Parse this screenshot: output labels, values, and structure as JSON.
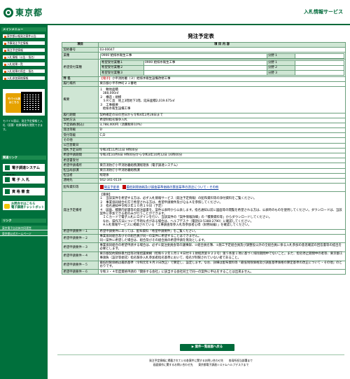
{
  "header": {
    "logo_text": "東京都",
    "site_title": "入札情報サービス"
  },
  "sidebar": {
    "menu_heading": "メインメニュー",
    "menu_items": [
      "東京都公報発注案件公告",
      "予算発注予定情報",
      "発注予定情報",
      "入札情報（公告・指名）",
      "入札結果一覧",
      "入札結果の照会・指名",
      "入札参加資格情報"
    ],
    "mobile_label": "モバイル版\nはこちら",
    "mobile_note": "モバイル版は、発注予定情報と入札（見積）結果情報を閲覧できます。",
    "link_heading": "関連リンク",
    "big_links": [
      "電子調達システム(TOP)",
      "電 子 入 札",
      "資 格 審 査"
    ],
    "chat_label": "お問合せはこちら\n電子調達チャットボット",
    "bottom_heading": "リンク",
    "bottom_links": [
      "東京電子自治体共同運営",
      "東京都公式ホームページ"
    ]
  },
  "main": {
    "page_title": "発注予定表",
    "col_item": "項目",
    "col_content": "項 目 内 容",
    "contract_no_label": "契約番号",
    "contract_no": "03-00047",
    "business_label": "業種",
    "business": "0900 給排水衛生工事",
    "bunya_label": "分野 1",
    "desired_label": "希望受付業種",
    "desired": [
      {
        "label": "希望受付業種１",
        "value": "0900 給排水衛生工事",
        "bunya": "分野 1"
      },
      {
        "label": "希望受付業種２",
        "value": "",
        "bunya": "分野 2"
      },
      {
        "label": "希望受付業種３",
        "value": "",
        "bunya": "分野 3"
      }
    ],
    "title_label": "件 名",
    "title_tag": "【電子】",
    "title": "小平消防署（３）給排水衛生設備改修工事",
    "place_label": "履行場所",
    "place": "東京都小平市仲町２１番地",
    "summary_label": "概要",
    "summary_lines": [
      "１　敷地面積",
      "　388,000㎡",
      "２　構造・規模",
      "　ＳＲＣ造　地上3階地下1階、延床面積2,019.675㎡",
      "３　工事概要",
      "　給排水衛生設備工事"
    ],
    "period_label": "履行期間",
    "period": "契約確定の日の翌日から令和4年2月28日まで",
    "method_label": "契約方法",
    "method": "希望制指名競争入札",
    "price_label": "予定価格(税込)",
    "price": "3,788,400円（消費税率10%）",
    "grade_label": "発注等級",
    "grade": "D",
    "grade2_label": "受付等級",
    "grade2": "C,D",
    "other_label": "その他",
    "other": "",
    "bid_label": "公告登載日",
    "bid": "",
    "open_label": "開札予定日時",
    "open": "令和3年11月11日 9時00分",
    "apply_label": "希望申請期間",
    "apply": "令和3年10月6日 9時00分から令和3年10月12日 16時00分",
    "receipt_label": "希望書受付",
    "receipt": "",
    "dept_label": "希望申請場所",
    "dept": "東京消防庁小平消防署総務課経理係（電子調達システム）",
    "dept2_label": "担当局部課",
    "dept2": "東京消防庁小平消防署総務課",
    "person_label": "担当者",
    "person": "経理係",
    "tel_label": "連絡先",
    "tel": "042-341-0119",
    "docs_label": "配布資料等",
    "doc1": "発注予定表",
    "doc2": "最低制限価格及び調査基準価格の算定基準の改正について・その他",
    "remarks_label": "発注予定備考",
    "remarks_lines": [
      "【重要】",
      "１　当該案件を希望する方は、必ず入札情報サービス（発注予定情報）の配布資料等の添付資料をご覧ください。",
      "２　事業協同組合の方で希望される方は、希望申請要件及びＱ＆Ａを参照してください。",
      "３　指名通知中令和３年１０月１９日（予定）",
      "４　図面、積算内訳書等の発注図書を、案件公表時から公表します。指名通知以前に図面等の閲覧を希望される方は、公表時のものを使用してください。ダウンロードは、当該案件に参加できる者のみが行うことができます。",
      "　ＩＣカードで電子入札にログインを行い、当該案件の「案件情報詳細」の「積算資料等」からダウンロードしてください。",
      "　なお、操作方法について不明な点がある場合は、ヘルプデスク（電話03-5388-2790）に確認してください。",
      "　※入札情報サービスに掲載されている「工事調査等参入札等参加者心得（財務局編）」を確認してください。"
    ],
    "req1_label": "希望申請要件－１",
    "req1": "希望申請要件にあっては、配布資料「希望申請要件」をご覧ください。",
    "req2_label": "希望申請要件－２",
    "req2": "事業協同組合及びその組合員が同一の案件に希望することはできません。\n同一案件に希望した場合は、組合及びその組合員の希望申請を無効とします。",
    "req3_label": "希望申請要件－３",
    "req3": "事業協同組合の希望申請する場合は、必ず①発注委員会等の議事録、②組合員名簿、③施工予定組合員及び調整役以外の全組合員に係る入札参加の意思確認の回答書等の提出を必要とします。",
    "req4_label": "希望申請要件－４",
    "req4": "東京都契約関係暴力団等対策措置要綱（昭和６２年１月１４日付６１財経庶第９２２号）第５条第１項に基づく排除期間中でないこと。また、指名停止期間中の者等、東京都工事請負（設計等委託）指名競争入札参加者指名基準において、指名が制限されていない者であること。",
    "req5_label": "希望申請要件－５",
    "req5": "最低制限価格は最新基準（令和元年９月３日改正）で算定し、設定します。なお、詳細は配布資料等「最低制限価格及び調査基準価格の算定基準の改正について・その他」のとおりです。",
    "req6_label": "希望申請要件－６",
    "req6": "令和３・４年度資格申請の「関係する会社」に該当する会社同士で同一の案件に申込をすることは出来ません。",
    "back_button": "▶ 案件一覧画面へ戻る"
  },
  "footer": {
    "line1": "発注予定情報に掲載されている各案件に関するお問い合わせ先　　各局所担当部署まで",
    "line2": "画面操作に関するお問い合わせ先　　東京都電子調達システムヘルプデスクまで"
  }
}
